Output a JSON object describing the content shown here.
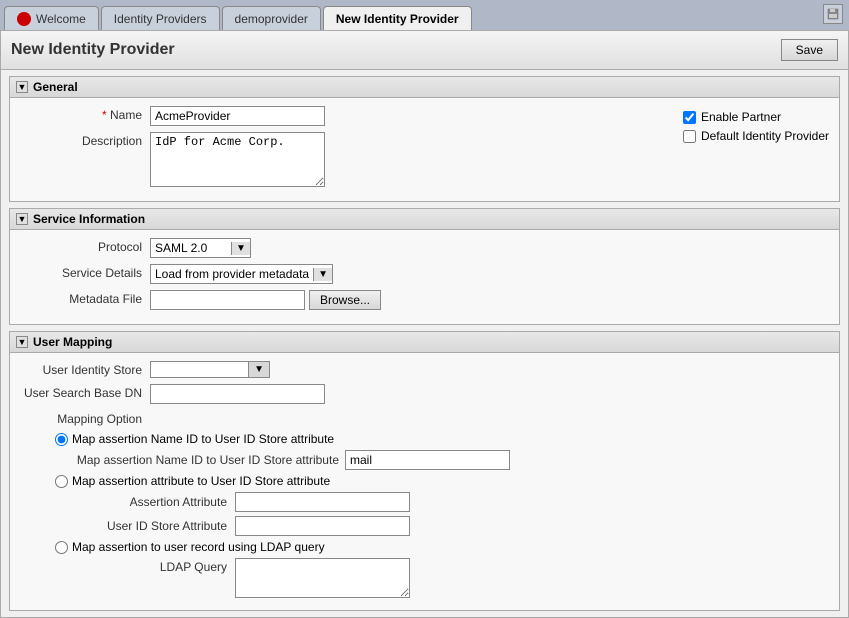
{
  "tabs": [
    {
      "id": "welcome",
      "label": "Welcome",
      "active": false,
      "has_icon": true
    },
    {
      "id": "identity-providers",
      "label": "Identity Providers",
      "active": false,
      "has_icon": false
    },
    {
      "id": "demoprovider",
      "label": "demoprovider",
      "active": false,
      "has_icon": false
    },
    {
      "id": "new-identity-provider",
      "label": "New Identity Provider",
      "active": true,
      "has_icon": false
    }
  ],
  "page": {
    "title": "New Identity Provider",
    "save_label": "Save"
  },
  "general": {
    "section_label": "General",
    "name_label": "Name",
    "name_value": "AcmeProvider",
    "description_label": "Description",
    "description_value": "IdP for Acme Corp.",
    "enable_partner_label": "Enable Partner",
    "enable_partner_checked": true,
    "default_idp_label": "Default Identity Provider",
    "default_idp_checked": false
  },
  "service_information": {
    "section_label": "Service Information",
    "protocol_label": "Protocol",
    "protocol_value": "SAML 2.0",
    "service_details_label": "Service Details",
    "service_details_value": "Load from provider metadata",
    "metadata_file_label": "Metadata File",
    "metadata_file_value": "",
    "browse_label": "Browse..."
  },
  "user_mapping": {
    "section_label": "User Mapping",
    "user_identity_store_label": "User Identity Store",
    "user_search_base_dn_label": "User Search Base DN",
    "mapping_option_label": "Mapping Option",
    "radio1_label": "Map assertion Name ID to User ID Store attribute",
    "radio1_sublabel": "Map assertion Name ID to User ID Store attribute",
    "radio1_value": "mail",
    "radio2_label": "Map assertion attribute to User ID Store attribute",
    "assertion_attribute_label": "Assertion Attribute",
    "user_id_store_attribute_label": "User ID Store Attribute",
    "radio3_label": "Map assertion to user record using LDAP query",
    "ldap_query_label": "LDAP Query"
  }
}
